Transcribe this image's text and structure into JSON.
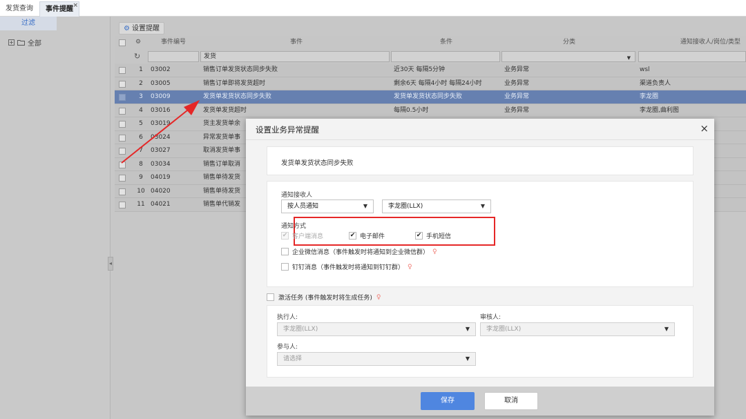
{
  "tabs": [
    {
      "label": "发货查询"
    },
    {
      "label": "事件提醒",
      "close": "×"
    }
  ],
  "sidebar": {
    "filter_tab": "过滤",
    "tree_toggle": "+",
    "tree_root": "全部",
    "collapse": "◂"
  },
  "toolbar": {
    "set_reminder": "设置提醒"
  },
  "grid": {
    "headers": {
      "gear": "⚙",
      "code": "事件编号",
      "event": "事件",
      "condition": "条件",
      "category": "分类",
      "receiver": "通知接收人/岗位/类型"
    },
    "filter": {
      "refresh": "↻",
      "event_value": "发货"
    },
    "rows": [
      {
        "no": "1",
        "code": "03002",
        "event": "销售订单发货状态同步失败",
        "condition": "近30天 每隔5分钟",
        "category": "业务异常",
        "receiver": "wsl"
      },
      {
        "no": "2",
        "code": "03005",
        "event": "销售订单即将发货超时",
        "condition": "剩余6天 每隔4小时 每隔24小时",
        "category": "业务异常",
        "receiver": "渠道负责人"
      },
      {
        "no": "3",
        "code": "03009",
        "event": "发货单发货状态同步失败",
        "condition": "发货单发货状态同步失败",
        "category": "业务异常",
        "receiver": "李龙圈"
      },
      {
        "no": "4",
        "code": "03016",
        "event": "发货单发货超时",
        "condition": "每隔0.5小时",
        "category": "业务异常",
        "receiver": "李龙圈,曲利图"
      },
      {
        "no": "5",
        "code": "03019",
        "event": "货主发货单余",
        "condition": "",
        "category": "",
        "receiver": ""
      },
      {
        "no": "6",
        "code": "03024",
        "event": "异常发货单事",
        "condition": "",
        "category": "",
        "receiver": ""
      },
      {
        "no": "7",
        "code": "03027",
        "event": "取消发货单事",
        "condition": "",
        "category": "",
        "receiver": ""
      },
      {
        "no": "8",
        "code": "03034",
        "event": "销售订单取消",
        "condition": "",
        "category": "",
        "receiver": ""
      },
      {
        "no": "9",
        "code": "04019",
        "event": "销售单待发货",
        "condition": "",
        "category": "",
        "receiver": ""
      },
      {
        "no": "10",
        "code": "04020",
        "event": "销售单待发货",
        "condition": "",
        "category": "",
        "receiver": ""
      },
      {
        "no": "11",
        "code": "04021",
        "event": "销售单代销发",
        "condition": "",
        "category": "",
        "receiver": ""
      }
    ]
  },
  "dialog": {
    "title": "设置业务异常提醒",
    "close": "×",
    "event_name": "发货单发货状态同步失败",
    "receiver_label": "通知接收人",
    "notify_by": "按人员通知",
    "receiver_value": "李龙圈(LLX)",
    "method_label": "通知方式",
    "methods": {
      "client": "客户端消息",
      "email": "电子邮件",
      "sms": "手机短信"
    },
    "wecom": "企业微信消息（事件触发时将通知到企业微信群）",
    "dingtalk": "钉钉消息（事件触发时将通知到钉钉群）",
    "activate_task": "激活任务 (事件触发时将生成任务)",
    "executor_label": "执行人:",
    "executor_value": "李龙圈(LLX)",
    "reviewer_label": "审核人:",
    "reviewer_value": "李龙圈(LLX)",
    "participant_label": "参与人:",
    "participant_placeholder": "请选择",
    "save": "保存",
    "cancel": "取消"
  },
  "colors": {
    "highlight": "#e52727",
    "primary": "#4f86e0",
    "selected_row": "#6680b0"
  }
}
